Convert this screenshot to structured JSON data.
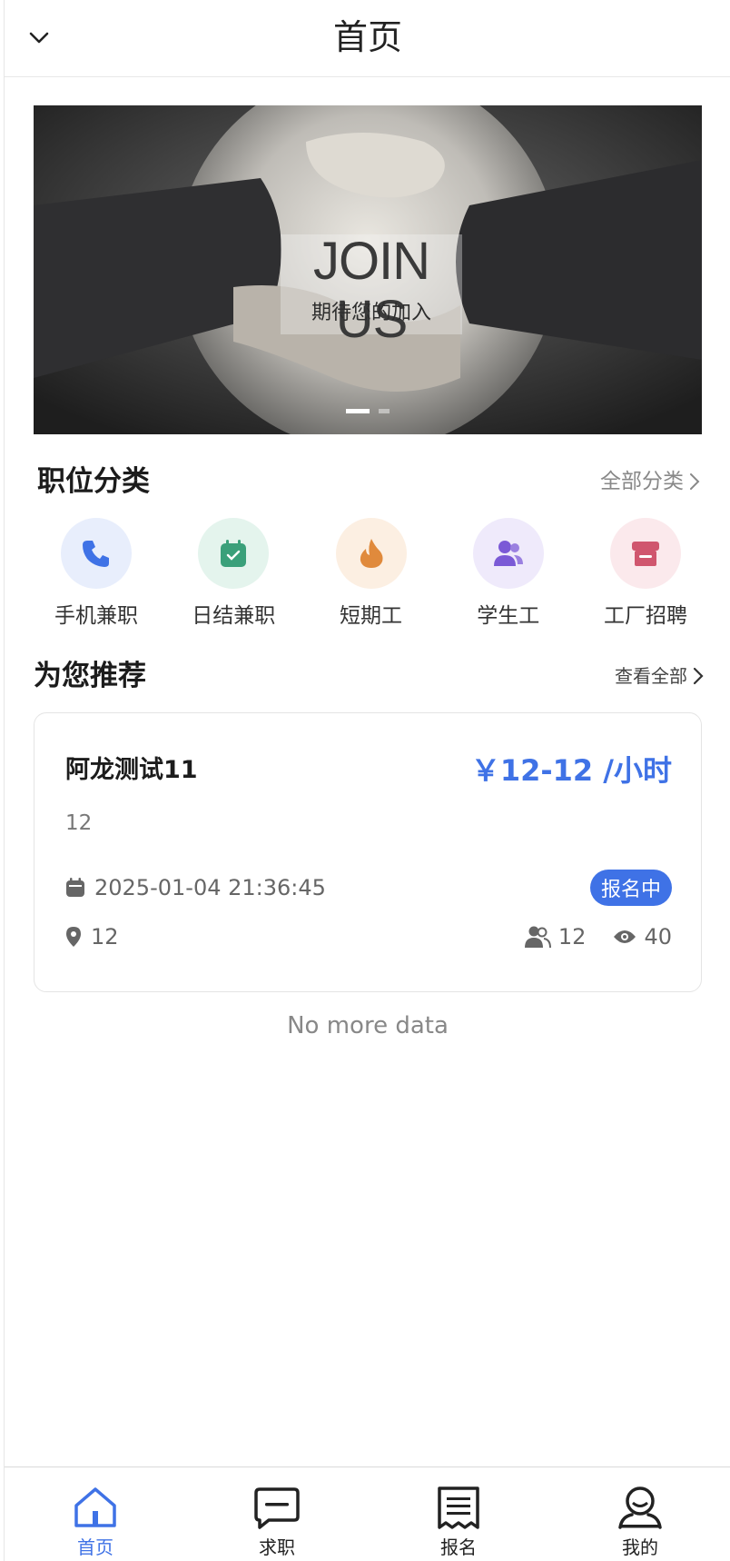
{
  "header": {
    "title": "首页"
  },
  "banner": {
    "headline": "JOIN US",
    "subline": "期待您的加入",
    "slide_count": 2,
    "active_slide": 1
  },
  "categories": {
    "title": "职位分类",
    "more_label": "全部分类",
    "items": [
      {
        "label": "手机兼职",
        "icon": "phone-icon",
        "color": "#3f72e6",
        "bg": "#e8eefc"
      },
      {
        "label": "日结兼职",
        "icon": "calendar-check-icon",
        "color": "#3aa07a",
        "bg": "#e4f4ed"
      },
      {
        "label": "短期工",
        "icon": "flame-icon",
        "color": "#e08a3c",
        "bg": "#fcefe2"
      },
      {
        "label": "学生工",
        "icon": "users-icon",
        "color": "#7b5ad6",
        "bg": "#efeafb"
      },
      {
        "label": "工厂招聘",
        "icon": "store-icon",
        "color": "#d0566e",
        "bg": "#fbe9ec"
      }
    ]
  },
  "recommend": {
    "title": "为您推荐",
    "more_label": "查看全部",
    "jobs": [
      {
        "title": "阿龙测试11",
        "salary": "￥12-12 /小时",
        "description": "12",
        "datetime": "2025-01-04 21:36:45",
        "status": "报名中",
        "location": "12",
        "applicants": "12",
        "views": "40"
      }
    ],
    "end_text": "No more data"
  },
  "tabbar": {
    "items": [
      {
        "label": "首页",
        "icon": "home-icon",
        "active": true
      },
      {
        "label": "求职",
        "icon": "message-icon",
        "active": false
      },
      {
        "label": "报名",
        "icon": "receipt-icon",
        "active": false
      },
      {
        "label": "我的",
        "icon": "user-icon",
        "active": false
      }
    ]
  },
  "colors": {
    "accent": "#3f72e6",
    "text": "#222222",
    "muted": "#888888"
  }
}
